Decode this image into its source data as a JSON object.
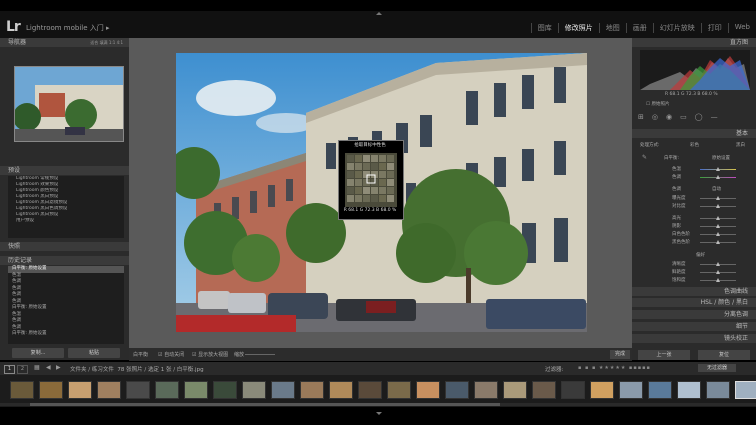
{
  "app": {
    "logo": "Lr",
    "title": "Lightroom mobile 入门",
    "title_arrow": "▸"
  },
  "modules": [
    "图库",
    "修改照片",
    "地图",
    "画册",
    "幻灯片放映",
    "打印",
    "Web"
  ],
  "active_module": "修改照片",
  "left": {
    "navigator": {
      "title": "导航器",
      "zoom_options": [
        "适合",
        "填满",
        "1:1",
        "4:1"
      ]
    },
    "presets": {
      "title": "预设",
      "items": [
        "Lightroom 常规预设",
        "Lightroom 效果预设",
        "Lightroom 颜色预设",
        "Lightroom 黑白预设",
        "Lightroom 黑白滤镜预设",
        "Lightroom 黑白色调预设",
        "Lightroom 黑白预设",
        "用户预设"
      ]
    },
    "snapshots": {
      "title": "快照"
    },
    "history": {
      "title": "历史记录",
      "rows": [
        {
          "label": "白平衡: 原始设置",
          "a": "",
          "b": ""
        },
        {
          "label": "色温",
          "a": "",
          "b": ""
        },
        {
          "label": "色调",
          "a": "",
          "b": ""
        },
        {
          "label": "色调",
          "a": "",
          "b": ""
        },
        {
          "label": "色调",
          "a": "",
          "b": ""
        },
        {
          "label": "色调",
          "a": "",
          "b": ""
        },
        {
          "label": "白平衡: 原始设置",
          "a": "",
          "b": ""
        },
        {
          "label": "色温",
          "a": "",
          "b": ""
        },
        {
          "label": "色调",
          "a": "",
          "b": ""
        },
        {
          "label": "色调",
          "a": "",
          "b": ""
        },
        {
          "label": "白平衡: 原始设置",
          "a": "",
          "b": ""
        }
      ]
    },
    "copy_button": "复制...",
    "paste_button": "粘贴"
  },
  "loupe": {
    "title": "拾取目标中性色",
    "readout": "R 68.1   G 72.3   B 68.0 %"
  },
  "toolbar": {
    "wb_label": "白平衡",
    "auto_dismiss": "自动关闭",
    "show_loupe": "显示放大视图",
    "scale": "缩放",
    "done": "完成"
  },
  "right": {
    "histogram": {
      "title": "直方图",
      "readout": "R 68.1   G 72.3   B 68.0 %",
      "original": "原始照片"
    },
    "basic": {
      "title": "基本",
      "treatment_label": "处理方式:",
      "color": "彩色",
      "bw": "黑白",
      "wb_label": "白平衡:",
      "wb_value": "原始设置",
      "temp": "色温",
      "tint": "色调",
      "tone": "色调",
      "auto": "自动",
      "exposure": "曝光度",
      "contrast": "对比度",
      "highlights": "高光",
      "shadows": "阴影",
      "whites": "白色色阶",
      "blacks": "黑色色阶",
      "presence": "偏好",
      "clarity": "清晰度",
      "vibrance": "鲜艳度",
      "saturation": "饱和度"
    },
    "panels": [
      "色调曲线",
      "HSL / 颜色 / 黑白",
      "分离色调",
      "细节",
      "镜头校正"
    ],
    "prev_button": "上一张",
    "reset_button": "复位"
  },
  "filmstrip": {
    "nav": "文件夹 / 练习文件",
    "count": "78 张照片 / 选定 1 张 / 白平衡.jpg",
    "filter_label": "过滤器:",
    "filter_value": "无过滤器",
    "pages": [
      "1",
      "2"
    ]
  }
}
